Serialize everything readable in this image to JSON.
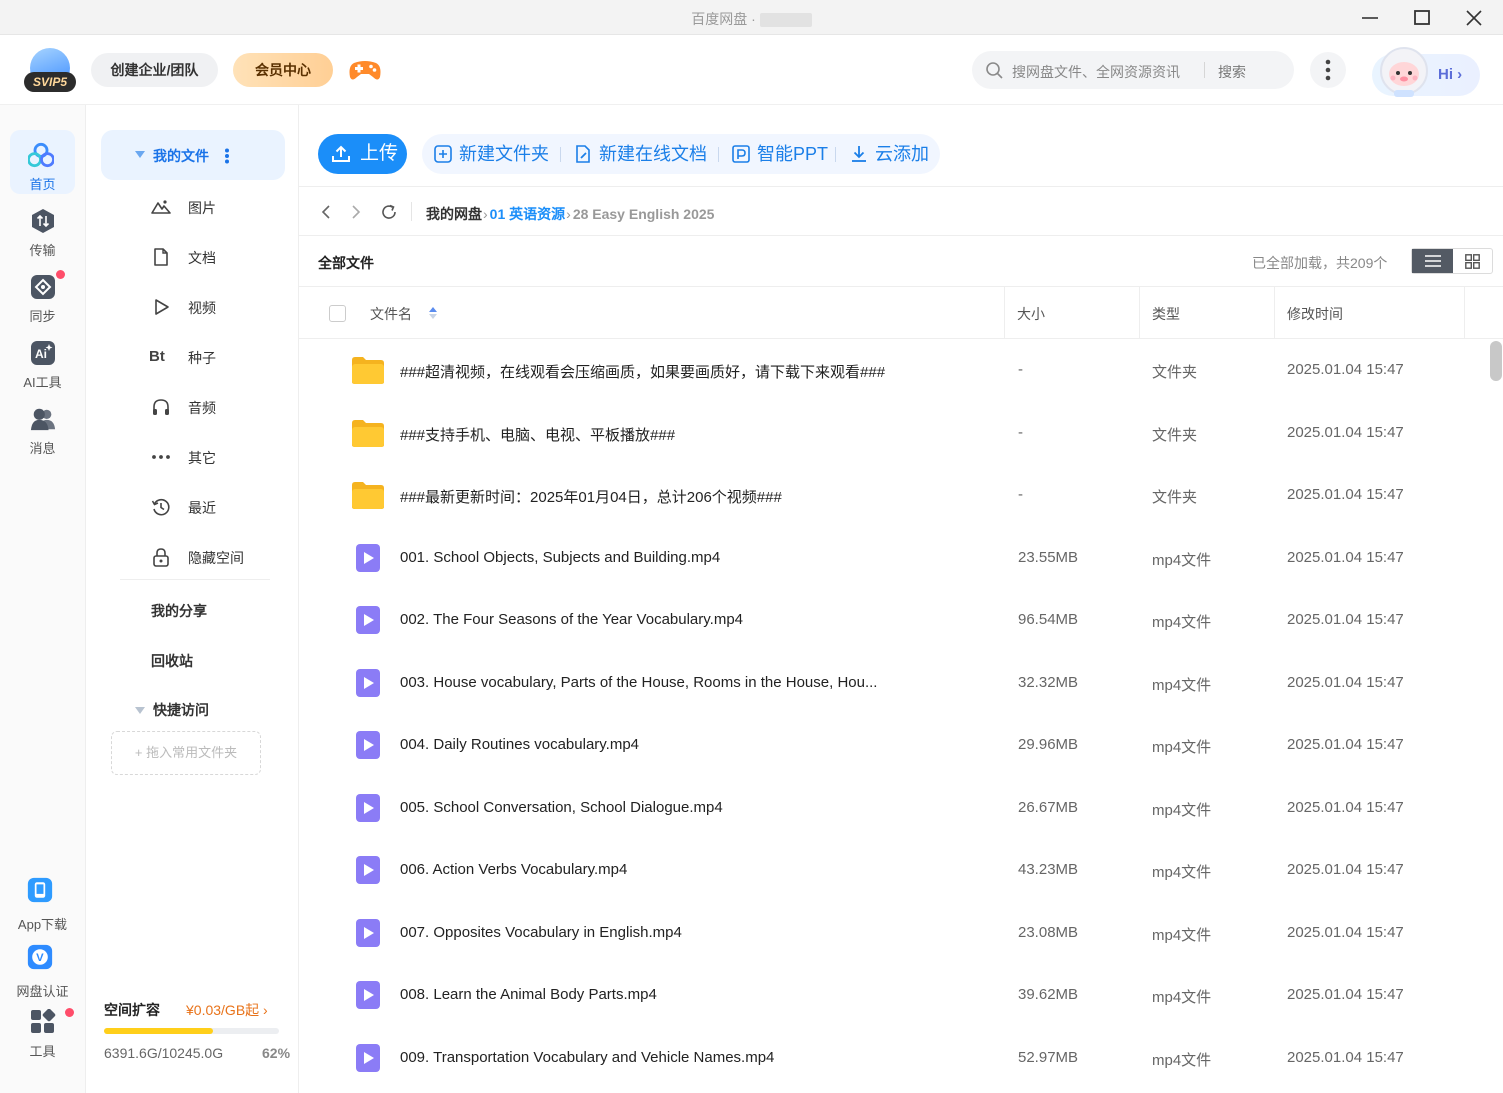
{
  "window": {
    "title": "百度网盘 ·"
  },
  "header": {
    "logo_badge": "SVIP5",
    "create_team": "创建企业/团队",
    "vip_center": "会员中心",
    "search_placeholder": "搜网盘文件、全网资源资讯",
    "search_button": "搜索",
    "greeting": "Hi"
  },
  "rail": {
    "items": [
      {
        "label": "首页",
        "icon": "home-icon"
      },
      {
        "label": "传输",
        "icon": "transfer-icon"
      },
      {
        "label": "同步",
        "icon": "sync-icon"
      },
      {
        "label": "AI工具",
        "icon": "ai-tool-icon"
      },
      {
        "label": "消息",
        "icon": "message-icon"
      }
    ],
    "bottom": [
      {
        "label": "App下载",
        "icon": "app-download-icon"
      },
      {
        "label": "网盘认证",
        "icon": "verify-icon"
      },
      {
        "label": "工具",
        "icon": "tools-icon"
      }
    ]
  },
  "sidebar": {
    "my_files": "我的文件",
    "items": [
      {
        "label": "图片",
        "icon": "image-icon"
      },
      {
        "label": "文档",
        "icon": "document-icon"
      },
      {
        "label": "视频",
        "icon": "video-icon"
      },
      {
        "label": "种子",
        "icon": "torrent-icon",
        "glyph": "Bt"
      },
      {
        "label": "音频",
        "icon": "headphones-icon"
      },
      {
        "label": "其它",
        "icon": "more-dots-icon"
      },
      {
        "label": "最近",
        "icon": "history-icon"
      },
      {
        "label": "隐藏空间",
        "icon": "lock-icon"
      }
    ],
    "my_share": "我的分享",
    "recycle_bin": "回收站",
    "quick_access": "快捷访问",
    "drop_hint": "+ 拖入常用文件夹",
    "storage": {
      "title": "空间扩容",
      "price": "¥0.03/GB起 ›",
      "used": "6391.6G/10245.0G",
      "percent_label": "62%",
      "percent": 62
    }
  },
  "toolbar": {
    "upload": "上传",
    "new_folder": "新建文件夹",
    "new_online_doc": "新建在线文档",
    "smart_ppt": "智能PPT",
    "cloud_add": "云添加"
  },
  "breadcrumb": {
    "root": "我的网盘",
    "level1": "01 英语资源",
    "current": "28 Easy English 2025"
  },
  "list": {
    "all_files": "全部文件",
    "count_text": "已全部加载，共209个",
    "columns": {
      "name": "文件名",
      "size": "大小",
      "type": "类型",
      "mtime": "修改时间"
    },
    "rows": [
      {
        "kind": "folder",
        "name": "###超清视频，在线观看会压缩画质，如果要画质好，请下载下来观看###",
        "size": "-",
        "type": "文件夹",
        "mtime": "2025.01.04 15:47"
      },
      {
        "kind": "folder",
        "name": "###支持手机、电脑、电视、平板播放###",
        "size": "-",
        "type": "文件夹",
        "mtime": "2025.01.04 15:47"
      },
      {
        "kind": "folder",
        "name": "###最新更新时间：2025年01月04日，总计206个视频###",
        "size": "-",
        "type": "文件夹",
        "mtime": "2025.01.04 15:47"
      },
      {
        "kind": "video",
        "name": "001. School Objects, Subjects and Building.mp4",
        "size": "23.55MB",
        "type": "mp4文件",
        "mtime": "2025.01.04 15:47"
      },
      {
        "kind": "video",
        "name": "002. The Four Seasons of the Year Vocabulary.mp4",
        "size": "96.54MB",
        "type": "mp4文件",
        "mtime": "2025.01.04 15:47"
      },
      {
        "kind": "video",
        "name": "003. House vocabulary, Parts of the House, Rooms in the House, Hou...",
        "size": "32.32MB",
        "type": "mp4文件",
        "mtime": "2025.01.04 15:47"
      },
      {
        "kind": "video",
        "name": "004. Daily Routines vocabulary.mp4",
        "size": "29.96MB",
        "type": "mp4文件",
        "mtime": "2025.01.04 15:47"
      },
      {
        "kind": "video",
        "name": "005. School Conversation, School Dialogue.mp4",
        "size": "26.67MB",
        "type": "mp4文件",
        "mtime": "2025.01.04 15:47"
      },
      {
        "kind": "video",
        "name": "006. Action Verbs Vocabulary.mp4",
        "size": "43.23MB",
        "type": "mp4文件",
        "mtime": "2025.01.04 15:47"
      },
      {
        "kind": "video",
        "name": "007. Opposites Vocabulary in English.mp4",
        "size": "23.08MB",
        "type": "mp4文件",
        "mtime": "2025.01.04 15:47"
      },
      {
        "kind": "video",
        "name": "008. Learn the Animal Body Parts.mp4",
        "size": "39.62MB",
        "type": "mp4文件",
        "mtime": "2025.01.04 15:47"
      },
      {
        "kind": "video",
        "name": "009. Transportation Vocabulary and Vehicle Names.mp4",
        "size": "52.97MB",
        "type": "mp4文件",
        "mtime": "2025.01.04 15:47"
      }
    ]
  },
  "colors": {
    "accent": "#1b8ef9",
    "folder": "#ffc933",
    "video": "#8b7cf6",
    "badge_red": "#ff4d6a",
    "storage_fill": "#ffcf1a"
  }
}
